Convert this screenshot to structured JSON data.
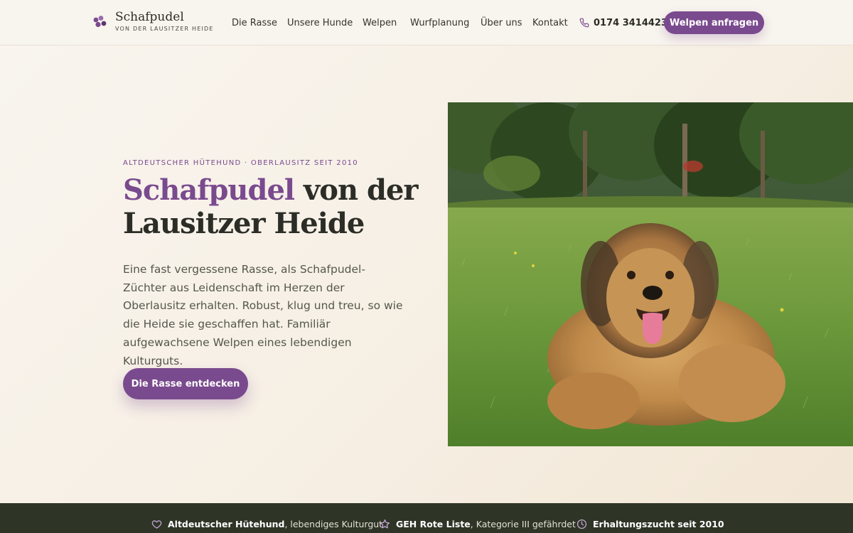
{
  "brand": {
    "name": "Schafpudel",
    "subtitle": "VON DER LAUSITZER HEIDE"
  },
  "nav": {
    "items": [
      {
        "label": "Die Rasse"
      },
      {
        "label": "Unsere Hunde"
      },
      {
        "label": "Welpen"
      },
      {
        "label": "Wurfplanung"
      },
      {
        "label": "Über uns"
      },
      {
        "label": "Kontakt"
      }
    ],
    "phone": "0174 3414423",
    "cta": "Welpen anfragen"
  },
  "hero": {
    "eyebrow": "ALTDEUTSCHER HÜTEHUND · OBERLAUSITZ SEIT 2010",
    "title_accent": "Schafpudel",
    "title_rest": " von der Lausitzer Heide",
    "lead": "Eine fast vergessene Rasse, als Schafpudel-Züchter aus Leidenschaft im Herzen der Oberlausitz erhalten. Robust, klug und treu, so wie die Heide sie geschaffen hat. Familiär aufgewachsene Welpen eines lebendigen Kulturguts.",
    "cta": "Die Rasse entdecken"
  },
  "strip": {
    "items": [
      {
        "icon": "heart-icon",
        "strong": "Altdeutscher Hütehund",
        "rest": ", lebendiges Kulturgut"
      },
      {
        "icon": "star-icon",
        "strong": "GEH Rote Liste",
        "rest": ", Kategorie III gefährdet"
      },
      {
        "icon": "clock-icon",
        "strong": "Erhaltungszucht seit 2010",
        "rest": ""
      }
    ]
  },
  "colors": {
    "accent": "#7a4a8e",
    "text": "#2b2d26",
    "strip": "#2e3527",
    "background": "#f6efe4"
  }
}
